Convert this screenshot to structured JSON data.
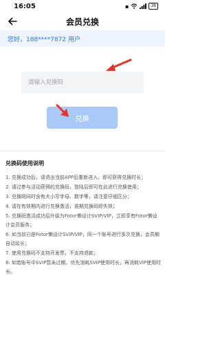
{
  "status_bar": {
    "time": "16:05",
    "battery": "38"
  },
  "nav": {
    "title": "会员兑换"
  },
  "user_banner": {
    "text": "您好，188****7872 用户"
  },
  "redeem": {
    "input_placeholder": "请输入兑换码",
    "input_value": "",
    "button_label": "兑换"
  },
  "instructions": {
    "title": "兑换码使用说明",
    "items": [
      "1. 兑换成功后，请退出当前APP后重新进入，即可获得兑换时长；",
      "2. 请过参与活动获得的兑换码，登陆后即可在此进行兑换使用；",
      "3. 兑换码同时含有大小写字母、数字等，请注意仔细区分；",
      "4. 请在有效期内进行兑换激活，逾期兑换码即失效；",
      "5. 兑换码激活成功后升级为Fotor懒设计SVIP/VIP，立即享有Fotor懒设计会员服务；",
      "6. 如当前已是Fotor懒设计SVIP/VIP，同一个账号进行多次兑换，会员期自动延长；",
      "7. 使用兑换码不支持开发票，不支持退款；",
      "8. 如若账号中SVIP暂未过期，优先消耗SVIP使用时长，再消耗VIP使用时长。"
    ]
  },
  "colors": {
    "accent": "#2f74e6",
    "button": "#a9c9f6",
    "banner_bg": "#eef4fd",
    "arrow": "#e8332b"
  },
  "icons": {
    "back": "arrow-left-icon",
    "wifi": "wifi-icon",
    "signal": "signal-icon"
  }
}
